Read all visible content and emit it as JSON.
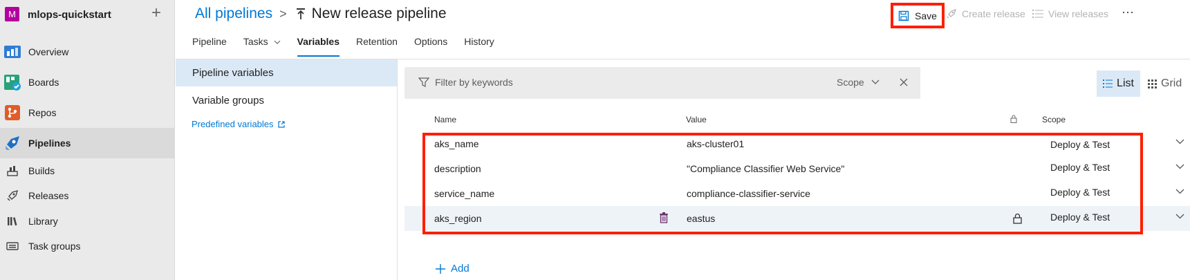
{
  "org": {
    "initial": "M",
    "name": "mlops-quickstart"
  },
  "nav": {
    "items": [
      {
        "label": "Overview",
        "icon": "overview-icon"
      },
      {
        "label": "Boards",
        "icon": "boards-icon"
      },
      {
        "label": "Repos",
        "icon": "repos-icon"
      },
      {
        "label": "Pipelines",
        "icon": "pipelines-icon"
      }
    ],
    "sub_items": [
      {
        "label": "Builds",
        "icon": "builds-icon"
      },
      {
        "label": "Releases",
        "icon": "releases-icon"
      },
      {
        "label": "Library",
        "icon": "library-icon"
      },
      {
        "label": "Task groups",
        "icon": "task-groups-icon"
      }
    ]
  },
  "header": {
    "breadcrumb_root": "All pipelines",
    "breadcrumb_sep": ">",
    "title": "New release pipeline",
    "save": "Save",
    "create_release": "Create release",
    "view_releases": "View releases",
    "more": "⋯"
  },
  "tabs": [
    "Pipeline",
    "Tasks",
    "Variables",
    "Retention",
    "Options",
    "History"
  ],
  "active_tab": "Variables",
  "left_panel": {
    "pipeline_variables": "Pipeline variables",
    "variable_groups": "Variable groups",
    "predefined_variables": "Predefined variables"
  },
  "filter": {
    "placeholder": "Filter by keywords",
    "scope": "Scope"
  },
  "view": {
    "list": "List",
    "grid": "Grid"
  },
  "table": {
    "headers": {
      "name": "Name",
      "value": "Value",
      "scope": "Scope"
    },
    "rows": [
      {
        "name": "aks_name",
        "value": "aks-cluster01",
        "scope": "Deploy & Test"
      },
      {
        "name": "description",
        "value": "\"Compliance Classifier Web Service\"",
        "scope": "Deploy & Test"
      },
      {
        "name": "service_name",
        "value": "compliance-classifier-service",
        "scope": "Deploy & Test"
      },
      {
        "name": "aks_region",
        "value": "eastus",
        "scope": "Deploy & Test"
      }
    ]
  },
  "add_label": "Add",
  "colors": {
    "accent": "#0078d4",
    "highlight": "#ff1e00",
    "selected_bg": "#dbe9f7"
  }
}
